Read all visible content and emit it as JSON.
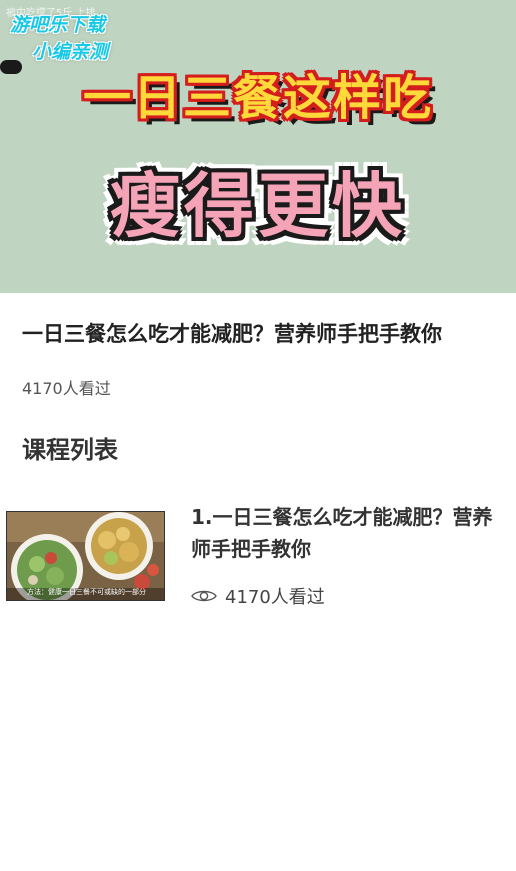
{
  "hero": {
    "tiny_caption": "被中吃撑了5斤 上排…",
    "watermark_line1": "游吧乐下载",
    "watermark_line2": "小编亲测",
    "headline_line1": "一日三餐这样吃",
    "headline_line2": "瘦得更快",
    "background_color": "#bfd4c1"
  },
  "course": {
    "title": "一日三餐怎么吃才能减肥？营养师手把手教你",
    "views": "4170人看过"
  },
  "section": {
    "heading": "课程列表"
  },
  "lessons": [
    {
      "title": "1.一日三餐怎么吃才能减肥？营养师手把手教你",
      "views": "4170人看过",
      "thumbnail_caption": "方法：健康一日三餐不可或缺的一部分",
      "view_icon": "eye-icon"
    }
  ]
}
